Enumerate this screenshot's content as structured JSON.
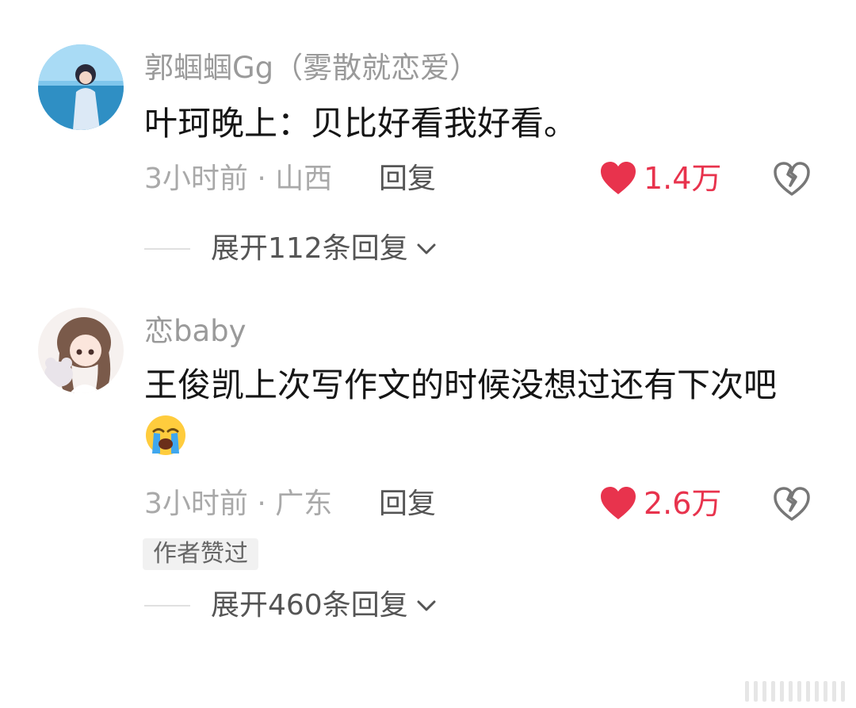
{
  "comments": [
    {
      "username": "郭蝈蝈Gg（雾散就恋爱）",
      "text": "叶珂晚上：贝比好看我好看。",
      "meta": "3小时前 · 山西",
      "reply_label": "回复",
      "likes": "1.4万",
      "expand_label": "展开112条回复",
      "avatar_icon": "avatar-photo-icon"
    },
    {
      "username": "恋baby",
      "text": "王俊凯上次写作文的时候没想过还有下次吧",
      "emoji_icon": "loudly-crying-face-icon",
      "meta": "3小时前 · 广东",
      "reply_label": "回复",
      "likes": "2.6万",
      "badge": "作者赞过",
      "expand_label": "展开460条回复",
      "avatar_icon": "avatar-anime-girl-icon"
    }
  ],
  "colors": {
    "like_red": "#e8334d",
    "username_gray": "#9a9a9a",
    "text_dark": "#151515"
  }
}
